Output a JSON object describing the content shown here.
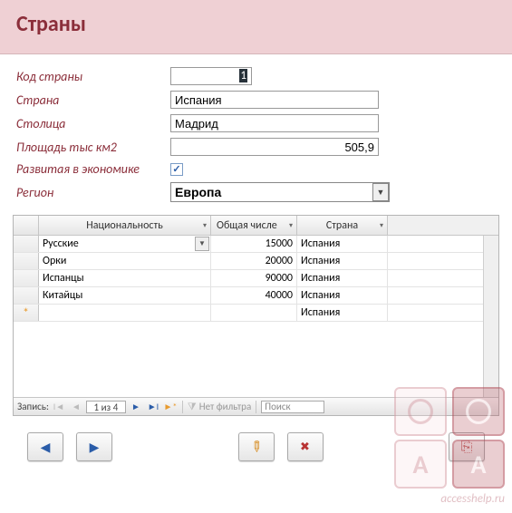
{
  "title": "Страны",
  "form": {
    "code_label": "Код страны",
    "code_value": "1",
    "country_label": "Страна",
    "country_value": "Испания",
    "capital_label": "Столица",
    "capital_value": "Мадрид",
    "area_label": "Площадь тыс км2",
    "area_value": "505,9",
    "developed_label": "Развитая в экономике",
    "developed_checked": true,
    "region_label": "Регион",
    "region_value": "Европа"
  },
  "subgrid": {
    "headers": {
      "nationality": "Национальность",
      "population": "Общая числе",
      "country": "Страна"
    },
    "rows": [
      {
        "nationality": "Русские",
        "population": "15000",
        "country": "Испания",
        "active": true
      },
      {
        "nationality": "Орки",
        "population": "20000",
        "country": "Испания",
        "active": false
      },
      {
        "nationality": "Испанцы",
        "population": "90000",
        "country": "Испания",
        "active": false
      },
      {
        "nationality": "Китайцы",
        "population": "40000",
        "country": "Испания",
        "active": false
      }
    ],
    "new_row_country": "Испания"
  },
  "nav": {
    "record_label": "Запись:",
    "position": "1 из 4",
    "filter_label": "Нет фильтра",
    "search_placeholder": "Поиск"
  },
  "watermark": "accesshelp.ru"
}
